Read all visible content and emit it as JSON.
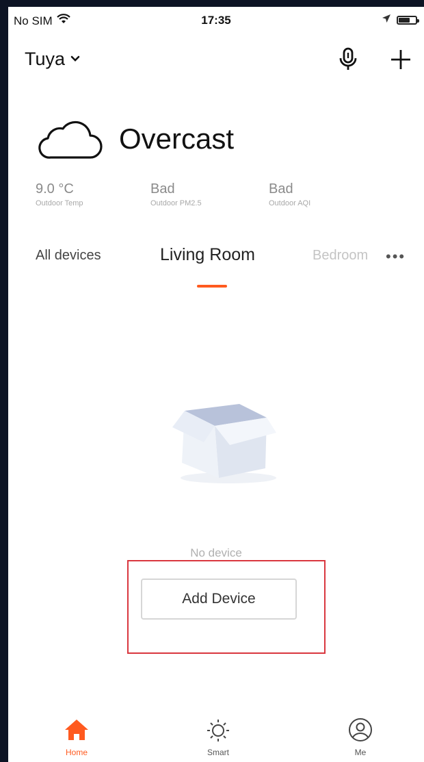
{
  "status_bar": {
    "carrier": "No SIM",
    "time": "17:35"
  },
  "header": {
    "home_name": "Tuya"
  },
  "weather": {
    "condition": "Overcast",
    "stats": [
      {
        "value": "9.0 °C",
        "label": "Outdoor Temp"
      },
      {
        "value": "Bad",
        "label": "Outdoor PM2.5"
      },
      {
        "value": "Bad",
        "label": "Outdoor AQI"
      }
    ]
  },
  "rooms": {
    "tabs": [
      "All devices",
      "Living Room",
      "Bedroom"
    ],
    "active_tab": "Living Room",
    "more": "•••"
  },
  "empty_state": {
    "message": "No device",
    "button_label": "Add Device"
  },
  "bottom_nav": {
    "items": [
      {
        "label": "Home",
        "icon": "home-icon",
        "active": true
      },
      {
        "label": "Smart",
        "icon": "sun-icon",
        "active": false
      },
      {
        "label": "Me",
        "icon": "user-icon",
        "active": false
      }
    ]
  },
  "colors": {
    "accent": "#ff5a1f",
    "highlight": "#d9363e"
  }
}
